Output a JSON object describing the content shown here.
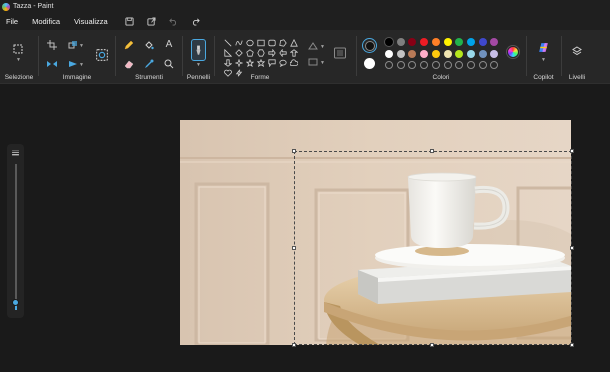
{
  "window": {
    "title": "Tazza - Paint"
  },
  "menu": {
    "items": [
      "File",
      "Modifica",
      "Visualizza"
    ],
    "quick_access": [
      "save-icon",
      "share-icon",
      "undo-icon",
      "redo-icon"
    ]
  },
  "ribbon": {
    "groups": {
      "selection": "Selezione",
      "image": "Immagine",
      "tools": "Strumenti",
      "brushes": "Pennelli",
      "shapes": "Forme",
      "colors": "Colori",
      "copilot": "Copilot",
      "layers": "Livelli"
    },
    "tools": [
      "pencil-icon",
      "fill-icon",
      "text-icon",
      "eraser-icon",
      "color-picker-icon",
      "magnifier-icon"
    ],
    "shapes": [
      "line",
      "curve",
      "oval",
      "rectangle",
      "rounded-rectangle",
      "polygon",
      "triangle",
      "right-triangle",
      "diamond",
      "pentagon",
      "hexagon",
      "arrow-right",
      "arrow-left",
      "arrow-up",
      "arrow-down",
      "star-four",
      "star-five",
      "star-six",
      "speech-bubble",
      "speech-oval",
      "cloud",
      "heart",
      "lightning"
    ],
    "colors": {
      "primary": "#111111",
      "secondary": "#ffffff",
      "row1": [
        "#000000",
        "#7f7f7f",
        "#880015",
        "#ed1c24",
        "#ff7f27",
        "#fff200",
        "#22b14c",
        "#00a2e8",
        "#3f48cc",
        "#a349a4"
      ],
      "row2": [
        "#ffffff",
        "#c3c3c3",
        "#b97a57",
        "#ffaec9",
        "#ffc90e",
        "#efe4b0",
        "#b5e61d",
        "#99d9ea",
        "#7092be",
        "#c8bfe7"
      ],
      "row3_custom_empty": 10
    }
  },
  "zoom_slider": {
    "level": 0.05
  },
  "canvas": {
    "image_description_colors": {
      "wall": "#dcc9b6",
      "table": "#e4c9a0",
      "book": "#e5e5e2",
      "cup": "#f4f3ef"
    }
  }
}
